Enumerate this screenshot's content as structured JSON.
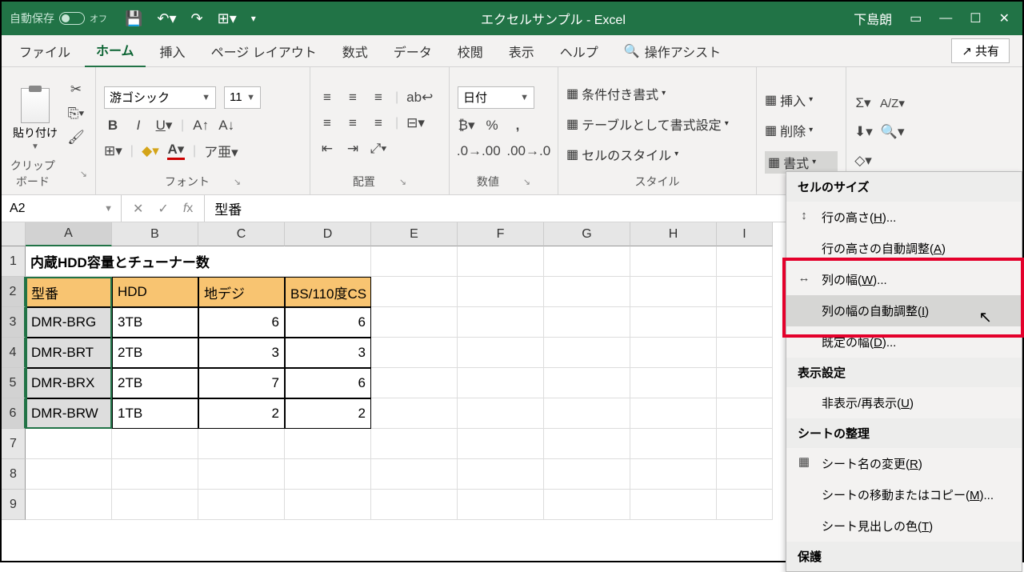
{
  "titlebar": {
    "autosave_label": "自動保存",
    "autosave_state": "オフ",
    "doc_title": "エクセルサンプル - Excel",
    "user": "下島朗"
  },
  "tabs": {
    "file": "ファイル",
    "home": "ホーム",
    "insert": "挿入",
    "page_layout": "ページ レイアウト",
    "formulas": "数式",
    "data": "データ",
    "review": "校閲",
    "view": "表示",
    "help": "ヘルプ",
    "tell_me": "操作アシスト",
    "share": "共有"
  },
  "ribbon": {
    "clipboard": {
      "paste": "貼り付け",
      "label": "クリップボード"
    },
    "font": {
      "name": "游ゴシック",
      "size": "11",
      "label": "フォント"
    },
    "alignment": {
      "label": "配置"
    },
    "number": {
      "format": "日付",
      "label": "数値"
    },
    "styles": {
      "cond": "条件付き書式",
      "table": "テーブルとして書式設定",
      "cell": "セルのスタイル",
      "label": "スタイル"
    },
    "cells": {
      "insert": "挿入",
      "delete": "削除",
      "format": "書式"
    }
  },
  "formula_bar": {
    "name_box": "A2",
    "formula": "型番"
  },
  "grid": {
    "columns": [
      "A",
      "B",
      "C",
      "D",
      "E",
      "F",
      "G",
      "H",
      "I"
    ],
    "row_labels": [
      "1",
      "2",
      "3",
      "4",
      "5",
      "6",
      "7",
      "8",
      "9"
    ],
    "title": "内蔵HDD容量とチューナー数",
    "headers": [
      "型番",
      "HDD",
      "地デジ",
      "BS/110度CS"
    ],
    "data": [
      [
        "DMR-BRG",
        "3TB",
        "6",
        "6"
      ],
      [
        "DMR-BRT",
        "2TB",
        "3",
        "3"
      ],
      [
        "DMR-BRX",
        "2TB",
        "7",
        "6"
      ],
      [
        "DMR-BRW",
        "1TB",
        "2",
        "2"
      ]
    ]
  },
  "dropdown": {
    "section_size": "セルのサイズ",
    "row_height": "行の高さ(H)...",
    "row_autofit": "行の高さの自動調整(A)",
    "col_width": "列の幅(W)...",
    "col_autofit": "列の幅の自動調整(I)",
    "default_width": "既定の幅(D)...",
    "section_vis": "表示設定",
    "hide_unhide": "非表示/再表示(U)",
    "section_org": "シートの整理",
    "rename": "シート名の変更(R)",
    "move_copy": "シートの移動またはコピー(M)...",
    "tab_color": "シート見出しの色(T)",
    "section_protect": "保護"
  }
}
